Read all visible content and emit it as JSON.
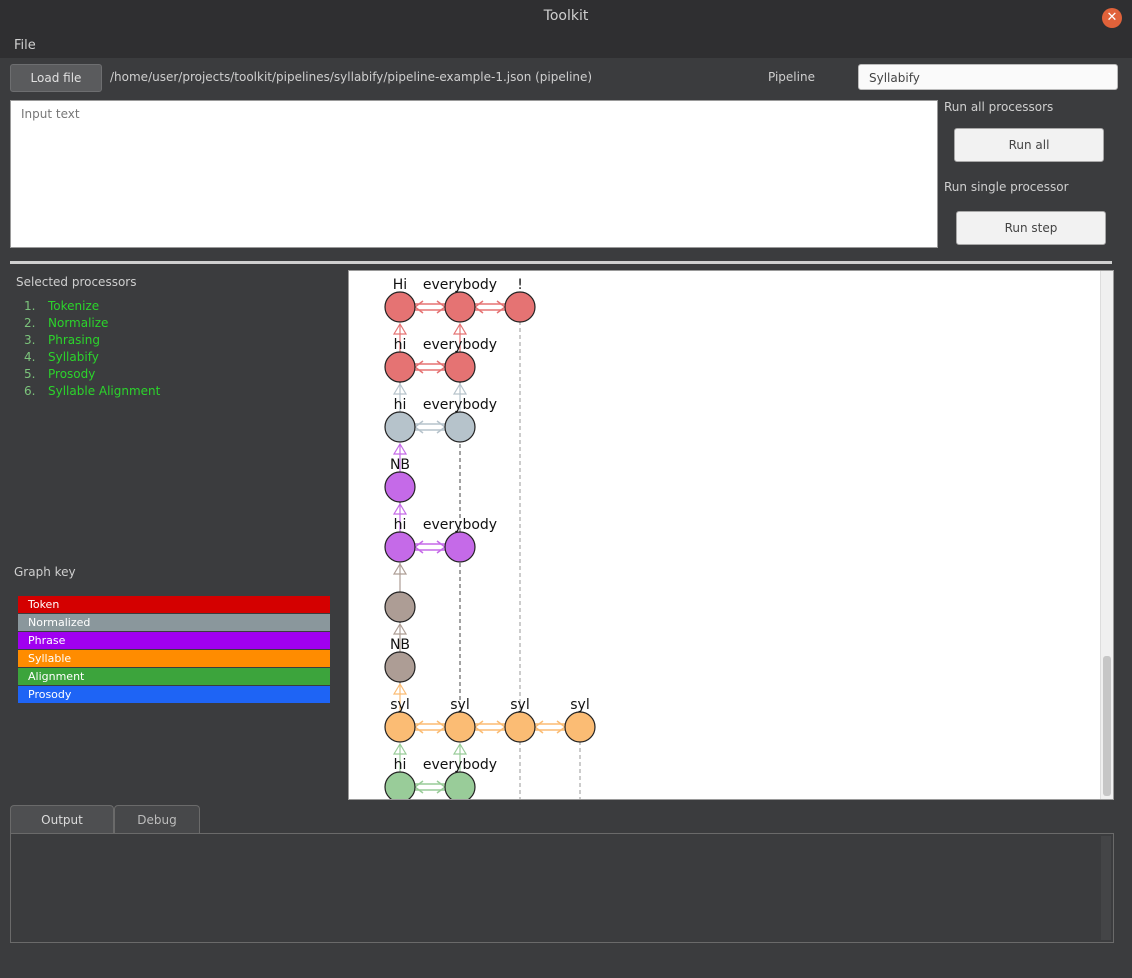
{
  "window": {
    "title": "Toolkit",
    "close_icon": "close-icon"
  },
  "menu": {
    "file": "File"
  },
  "toolbar": {
    "load_label": "Load file",
    "file_path": "/home/user/projects/toolkit/pipelines/syllabify/pipeline-example-1.json (pipeline)",
    "choose_label": "Pipeline",
    "pipeline_value": "Syllabify"
  },
  "input": {
    "placeholder": "Input text"
  },
  "run": {
    "all_label": "Run all processors",
    "all_button": "Run all",
    "single_label": "Run single processor",
    "step_button": "Run step"
  },
  "processors": {
    "label": "Selected processors",
    "items": [
      {
        "num": "1.",
        "name": "Tokenize"
      },
      {
        "num": "2.",
        "name": "Normalize"
      },
      {
        "num": "3.",
        "name": "Phrasing"
      },
      {
        "num": "4.",
        "name": "Syllabify"
      },
      {
        "num": "5.",
        "name": "Prosody"
      },
      {
        "num": "6.",
        "name": "Syllable Alignment"
      }
    ]
  },
  "graph_legend": {
    "label": "Graph key",
    "items": [
      {
        "label": "Token",
        "color": "#d40000"
      },
      {
        "label": "Normalized",
        "color": "#8a979c"
      },
      {
        "label": "Phrase",
        "color": "#a000f0"
      },
      {
        "label": "Syllable",
        "color": "#ff8c00"
      },
      {
        "label": "Alignment",
        "color": "#3ca43c"
      },
      {
        "label": "Prosody",
        "color": "#1e64f5"
      }
    ]
  },
  "graph": {
    "rows": [
      {
        "color": "#e57373",
        "labels": [
          "Hi",
          "everybody",
          "!"
        ]
      },
      {
        "color": "#e57373",
        "labels": [
          "hi",
          "everybody"
        ]
      },
      {
        "color": "#b6c3cb",
        "labels": [
          "hi",
          "everybody"
        ]
      },
      {
        "color": "#c56ae8",
        "labels": [
          "NB"
        ]
      },
      {
        "color": "#c56ae8",
        "labels": [
          "hi",
          "everybody"
        ]
      },
      {
        "color": "#ad9d95",
        "labels": [
          ""
        ]
      },
      {
        "color": "#ad9d95",
        "labels": [
          "NB"
        ]
      },
      {
        "color": "#fbbc74",
        "labels": [
          "syl",
          "syl",
          "syl",
          "syl"
        ]
      },
      {
        "color": "#99cc99",
        "labels": [
          "hi",
          "everybody"
        ]
      }
    ]
  },
  "tabs": {
    "output": "Output",
    "debug": "Debug"
  }
}
